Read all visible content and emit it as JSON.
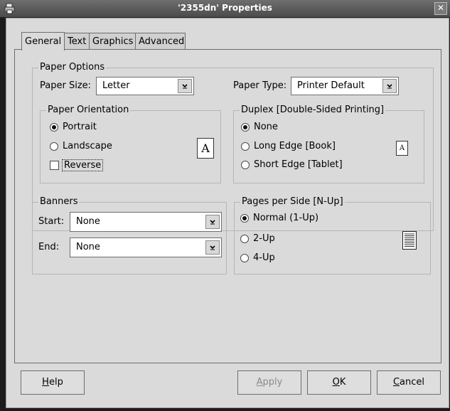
{
  "window": {
    "title": "'2355dn' Properties",
    "close_glyph": "✕"
  },
  "tabs": [
    {
      "label": "General",
      "active": true
    },
    {
      "label": "Text",
      "active": false
    },
    {
      "label": "Graphics",
      "active": false
    },
    {
      "label": "Advanced",
      "active": false
    }
  ],
  "paper_options": {
    "legend": "Paper Options",
    "paper_size_label": "Paper Size:",
    "paper_size_value": "Letter",
    "paper_type_label": "Paper Type:",
    "paper_type_value": "Printer Default",
    "orientation": {
      "legend": "Paper Orientation",
      "options": [
        {
          "label": "Portrait",
          "selected": true
        },
        {
          "label": "Landscape",
          "selected": false
        }
      ],
      "reverse_label": "Reverse",
      "reverse_checked": false,
      "preview_glyph": "A"
    },
    "duplex": {
      "legend": "Duplex [Double-Sided Printing]",
      "options": [
        {
          "label": "None",
          "selected": true
        },
        {
          "label": "Long Edge [Book]",
          "selected": false
        },
        {
          "label": "Short Edge [Tablet]",
          "selected": false
        }
      ],
      "preview_glyph": "A"
    }
  },
  "banners": {
    "legend": "Banners",
    "start_label": "Start:",
    "start_value": "None",
    "end_label": "End:",
    "end_value": "None"
  },
  "nup": {
    "legend": "Pages per Side [N-Up]",
    "options": [
      {
        "label": "Normal (1-Up)",
        "selected": true
      },
      {
        "label": "2-Up",
        "selected": false
      },
      {
        "label": "4-Up",
        "selected": false
      }
    ]
  },
  "buttons": {
    "help": {
      "mnemonic": "H",
      "rest": "elp"
    },
    "apply": {
      "mnemonic": "A",
      "rest": "pply",
      "enabled": false
    },
    "ok": {
      "mnemonic": "O",
      "rest": "K"
    },
    "cancel": {
      "mnemonic": "C",
      "rest": "ancel"
    }
  }
}
